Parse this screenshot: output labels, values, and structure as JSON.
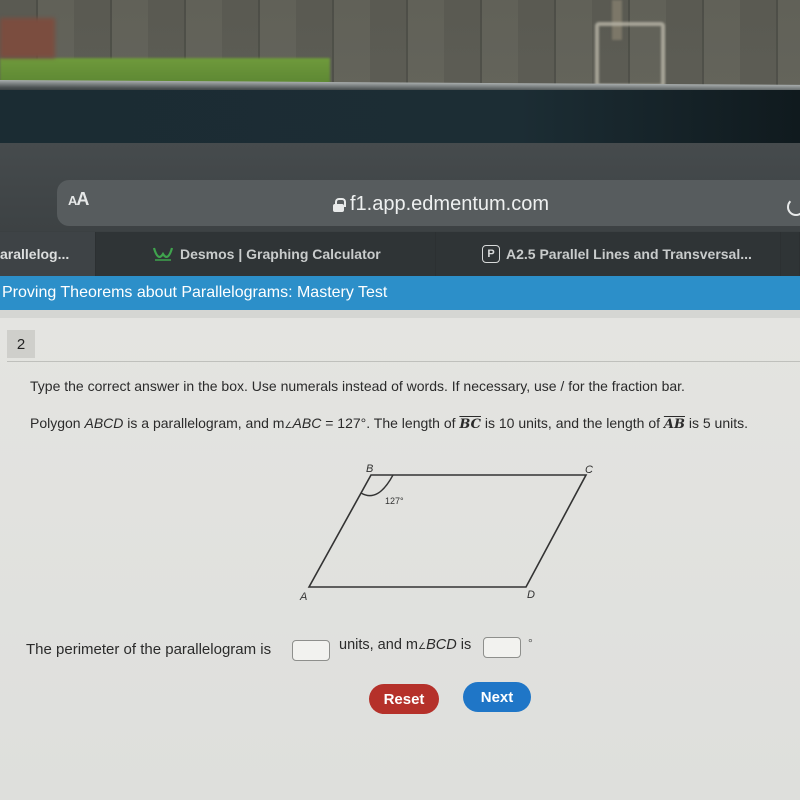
{
  "browser": {
    "text_size_label_small": "A",
    "text_size_label_large": "A",
    "url": "f1.app.edmentum.com",
    "tabs": [
      {
        "label": "arallelog...",
        "icon": "none"
      },
      {
        "label": "Desmos | Graphing Calculator",
        "icon": "desmos-logo-icon"
      },
      {
        "label": "A2.5 Parallel Lines and Transversal...",
        "icon": "p-badge-icon",
        "icon_text": "P"
      }
    ]
  },
  "page": {
    "title": "Proving Theorems about Parallelograms: Mastery Test",
    "question_number": "2",
    "instructions": "Type the correct answer in the box. Use numerals instead of words. If necessary, use / for the fraction bar.",
    "problem": {
      "part1": "Polygon ",
      "polygon": "ABCD",
      "part2": " is a parallelogram, and m",
      "angle_symbol": "∠",
      "angle_name": "ABC",
      "part3": " = 127°. The length of ",
      "segment1": "BC",
      "part4": " is 10 units, and the length of ",
      "segment2": "AB",
      "part5": " is 5 units."
    },
    "figure": {
      "vertices": {
        "A": "A",
        "B": "B",
        "C": "C",
        "D": "D"
      },
      "angle_label": "127°"
    },
    "answer": {
      "prefix": "The perimeter of the parallelogram is",
      "middle": "units, and m",
      "angle_symbol": "∠",
      "angle_name": "BCD",
      "middle_end": " is",
      "suffix": "°",
      "perimeter_value": "",
      "angle_value": ""
    },
    "buttons": {
      "reset": "Reset",
      "next": "Next"
    }
  },
  "colors": {
    "title_bar": "#2c8fc9",
    "reset_button": "#b5312a",
    "next_button": "#1f76c7"
  }
}
